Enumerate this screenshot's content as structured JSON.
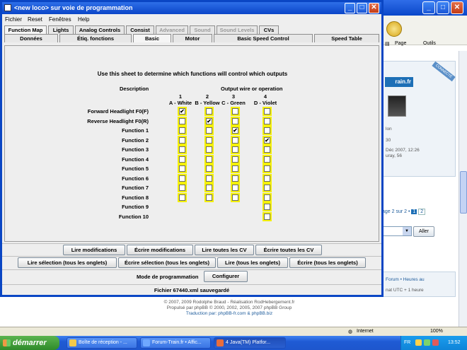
{
  "window": {
    "title": "<new loco> sur voie de programmation",
    "controls": {
      "minimize": "_",
      "maximize": "□",
      "close": "✕"
    }
  },
  "menu": [
    "Fichier",
    "Reset",
    "Fenêtres",
    "Help"
  ],
  "tabs_row1": [
    {
      "label": "Function Map",
      "active": true
    },
    {
      "label": "Lights",
      "active": false
    },
    {
      "label": "Analog Controls",
      "active": false
    },
    {
      "label": "Consist",
      "active": false
    },
    {
      "label": "Advanced",
      "disabled": true
    },
    {
      "label": "Sound",
      "disabled": true
    },
    {
      "label": "Sound Levels",
      "disabled": true
    },
    {
      "label": "CVs",
      "active": false
    }
  ],
  "tabs_row2": [
    "Données",
    "Étiq. fonctions",
    "Basic",
    "Motor",
    "Basic Speed Control",
    "Speed Table"
  ],
  "function_map": {
    "instruction": "Use this sheet to determine which functions will control which outputs",
    "description_header": "Description",
    "output_header": "Output wire or operation",
    "columns": [
      {
        "number": "1",
        "name": "A - White"
      },
      {
        "number": "2",
        "name": "B - Yellow"
      },
      {
        "number": "3",
        "name": "C - Green"
      },
      {
        "number": "4",
        "name": "D - Violet"
      }
    ],
    "rows": [
      {
        "label": "Forward Headlight F0(F)",
        "cells": [
          true,
          false,
          false,
          false
        ]
      },
      {
        "label": "Reverse Headlight F0(R)",
        "cells": [
          false,
          true,
          false,
          false
        ]
      },
      {
        "label": "Function 1",
        "cells": [
          false,
          false,
          true,
          false
        ]
      },
      {
        "label": "Function 2",
        "cells": [
          false,
          false,
          false,
          true
        ]
      },
      {
        "label": "Function 3",
        "cells": [
          false,
          false,
          false,
          false
        ]
      },
      {
        "label": "Function 4",
        "cells": [
          false,
          false,
          false,
          false
        ]
      },
      {
        "label": "Function 5",
        "cells": [
          false,
          false,
          false,
          false
        ]
      },
      {
        "label": "Function 6",
        "cells": [
          false,
          false,
          false,
          false
        ]
      },
      {
        "label": "Function 7",
        "cells": [
          false,
          false,
          false,
          false
        ]
      },
      {
        "label": "Function 8",
        "cells": [
          false,
          false,
          false,
          false
        ]
      },
      {
        "label": "Function 9",
        "cells": [
          null,
          null,
          null,
          false
        ]
      },
      {
        "label": "Function 10",
        "cells": [
          null,
          null,
          null,
          false
        ]
      }
    ]
  },
  "buttons_row1": [
    "Lire modifications",
    "Écrire modifications",
    "Lire toutes les CV",
    "Écrire toutes les CV"
  ],
  "buttons_row2": [
    "Lire sélection (tous les onglets)",
    "Écrire sélection (tous les onglets)",
    "Lire (tous les onglets)",
    "Écrire (tous les onglets)"
  ],
  "programming": {
    "label": "Mode de programmation",
    "button": "Configurer"
  },
  "status": "Fichier 67440.xml sauvegardé",
  "browser": {
    "tools": [
      "Page",
      "Outils"
    ],
    "forum_logo": "rain.fr",
    "connected": "CONNECTÉ",
    "side_text": [
      "lon",
      "30",
      "Déc 2007, 12:26",
      "uray, 56"
    ],
    "pager": {
      "prefix": "age 2 sur 2 •",
      "current": "1",
      "next": "2"
    },
    "go_button": "Aller",
    "info_lines": [
      "Forum • Heures au",
      "nat UTC + 1 heure"
    ],
    "footer": [
      "© 2007, 2009 Rodolphe Braud - Réalisation RodHebergement.fr",
      "Propulsé par phpBB © 2000, 2002, 2005, 2007 phpBB Group",
      "Traduction par: phpBB-fr.com & phpBB.biz"
    ],
    "statusbar_zone": "Internet",
    "zoom": "100%"
  },
  "taskbar": {
    "start": "démarrer",
    "tasks": [
      "Boîte de réception - ...",
      "Forum-Train.fr • Affic...",
      "4 Java(TM) Platfor..."
    ],
    "language": "FR",
    "clock": "13:52"
  }
}
